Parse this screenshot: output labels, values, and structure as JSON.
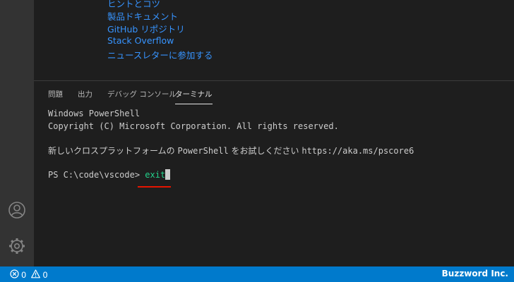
{
  "editor": {
    "links": [
      "ヒントとコツ",
      "製品ドキュメント",
      "GitHub リポジトリ",
      "Stack Overflow",
      "ニュースレターに参加する"
    ]
  },
  "panel": {
    "tabs": [
      {
        "label": "問題",
        "active": false
      },
      {
        "label": "出力",
        "active": false
      },
      {
        "label": "デバッグ コンソール",
        "active": false
      },
      {
        "label": "ターミナル",
        "active": true
      }
    ]
  },
  "terminal": {
    "line1": "Windows PowerShell",
    "line2": "Copyright (C) Microsoft Corporation. All rights reserved.",
    "line3_text": "新しいクロスプラットフォームの ",
    "line3_ps": "PowerShell",
    "line3_text2": " をお試しください ",
    "line3_url": "https://aka.ms/pscore6",
    "prompt": "PS C:\\code\\vscode> ",
    "command": "exit"
  },
  "status_bar": {
    "errors": "0",
    "warnings": "0",
    "brand": "Buzzword Inc."
  },
  "icons": {
    "account": "account-icon",
    "settings": "gear-icon",
    "error": "error-icon",
    "warning": "warning-icon"
  },
  "colors": {
    "status_bar": "#007acc",
    "link": "#3794ff",
    "command": "#23d18b",
    "highlight": "#e51400"
  }
}
